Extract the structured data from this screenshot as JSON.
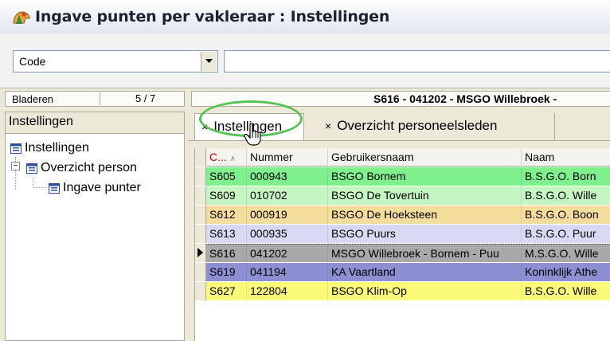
{
  "window": {
    "title": "Ingave punten per vakleraar : Instellingen"
  },
  "filter": {
    "field_label": "Code",
    "value": ""
  },
  "navigation": {
    "browse_label": "Bladeren",
    "page": "5 / 7",
    "current_record": "S616 - 041202 - MSGO Willebroek -"
  },
  "left_pane": {
    "header": "Instellingen",
    "tree": [
      {
        "label": "Instellingen",
        "icon": "form-icon",
        "level": 0
      },
      {
        "label": "Overzicht person",
        "icon": "form-icon",
        "level": 1,
        "expander": "⊟"
      },
      {
        "label": "Ingave punter",
        "icon": "form-icon",
        "level": 2
      }
    ]
  },
  "tabs": [
    {
      "label": "Instellingen",
      "close": "×",
      "active": true
    },
    {
      "label": "Overzicht personeelsleden",
      "close": "×",
      "active": false
    }
  ],
  "table": {
    "columns": [
      "C...",
      "Nummer",
      "Gebruikersnaam",
      "Naam"
    ],
    "sort_indicator": "∧",
    "rows": [
      {
        "code": "S605",
        "nummer": "000943",
        "gebruikersnaam": "BSGO Bornem",
        "naam": "B.S.G.O. Born",
        "color": "#7ef08e"
      },
      {
        "code": "S609",
        "nummer": "010702",
        "gebruikersnaam": "BSGO De Tovertuin",
        "naam": "B.S.G.O. Wille",
        "color": "#c5f5c2"
      },
      {
        "code": "S612",
        "nummer": "000919",
        "gebruikersnaam": "BSGO De Hoeksteen",
        "naam": "B.S.G.O. Boon",
        "color": "#f4dc9c"
      },
      {
        "code": "S613",
        "nummer": "000935",
        "gebruikersnaam": "BSGO Puurs",
        "naam": "B.S.G.O. Puur",
        "color": "#d8daf3"
      },
      {
        "code": "S616",
        "nummer": "041202",
        "gebruikersnaam": "MSGO Willebroek - Bornem - Puu",
        "naam": "M.S.G.O. Wille",
        "color": "#a9a9a9",
        "current": true
      },
      {
        "code": "S619",
        "nummer": "041194",
        "gebruikersnaam": "KA Vaartland",
        "naam": "Koninklijk Athe",
        "color": "#8c8fd2"
      },
      {
        "code": "S627",
        "nummer": "122804",
        "gebruikersnaam": "BSGO Klim-Op",
        "naam": "B.S.G.O. Wille",
        "color": "#fafa78"
      }
    ]
  },
  "colors": {
    "header_code": "#c00000",
    "tab_highlight": "#55c453"
  }
}
